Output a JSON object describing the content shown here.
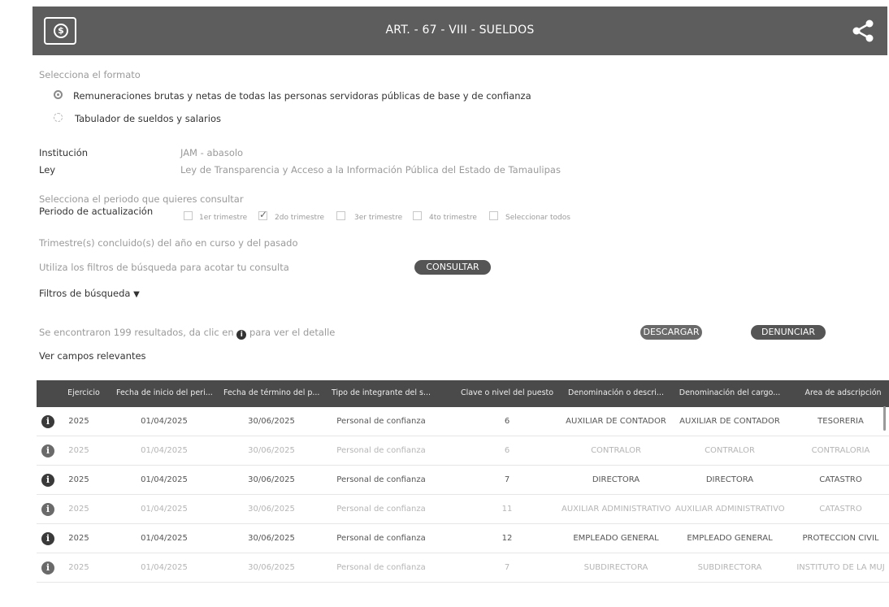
{
  "header": {
    "title": "ART. - 67 - VIII - SUELDOS"
  },
  "format": {
    "prompt": "Selecciona el formato",
    "options": [
      "Remuneraciones brutas y netas de todas las personas servidoras públicas de base y de confianza",
      "Tabulador de sueldos y salarios"
    ],
    "selected_index": 0
  },
  "meta": {
    "institution_label": "Institución",
    "institution_value": "JAM - abasolo",
    "law_label": "Ley",
    "law_value": "Ley de Transparencia y Acceso a la Información Pública del Estado de Tamaulipas"
  },
  "period": {
    "prompt": "Selecciona el periodo que quieres consultar",
    "label": "Periodo de actualización",
    "options": [
      {
        "label": "1er trimestre",
        "checked": false
      },
      {
        "label": "2do trimestre",
        "checked": true
      },
      {
        "label": "3er trimestre",
        "checked": false
      },
      {
        "label": "4to trimestre",
        "checked": false
      },
      {
        "label": "Seleccionar todos",
        "checked": false
      }
    ],
    "note": "Trimestre(s) concluido(s) del año en curso y del pasado"
  },
  "filters": {
    "hint": "Utiliza los filtros de búsqueda para acotar tu consulta",
    "consult_button": "CONSULTAR",
    "toggle_label": "Filtros de búsqueda"
  },
  "results": {
    "summary_prefix": "Se encontraron 199 resultados, da clic en",
    "summary_suffix": "para ver el detalle",
    "download_button": "DESCARGAR",
    "report_button": "DENUNCIAR",
    "relevant_fields_link": "Ver campos relevantes"
  },
  "table": {
    "headers": [
      "Ejercicio",
      "Fecha de inicio del peri...",
      "Fecha de término del p...",
      "Tipo de integrante del s...",
      "Clave o nivel del puesto",
      "Denominación o descri...",
      "Denominación del cargo...",
      "Área de adscripción"
    ],
    "rows": [
      {
        "cells": [
          "2025",
          "01/04/2025",
          "30/06/2025",
          "Personal de confianza",
          "6",
          "AUXILIAR DE CONTADOR",
          "AUXILIAR DE CONTADOR",
          "TESORERÍA"
        ],
        "faded": false
      },
      {
        "cells": [
          "2025",
          "01/04/2025",
          "30/06/2025",
          "Personal de confianza",
          "6",
          "CONTRALOR",
          "CONTRALOR",
          "CONTRALORÍA"
        ],
        "faded": true
      },
      {
        "cells": [
          "2025",
          "01/04/2025",
          "30/06/2025",
          "Personal de confianza",
          "7",
          "DIRECTORA",
          "DIRECTORA",
          "CATASTRO"
        ],
        "faded": false
      },
      {
        "cells": [
          "2025",
          "01/04/2025",
          "30/06/2025",
          "Personal de confianza",
          "11",
          "AUXILIAR ADMINISTRATIVO",
          "AUXILIAR ADMINISTRATIVO",
          "CATASTRO"
        ],
        "faded": true
      },
      {
        "cells": [
          "2025",
          "01/04/2025",
          "30/06/2025",
          "Personal de confianza",
          "12",
          "EMPLEADO GENERAL",
          "EMPLEADO GENERAL",
          "PROTECCIÓN CIVIL"
        ],
        "faded": false
      },
      {
        "cells": [
          "2025",
          "01/04/2025",
          "30/06/2025",
          "Personal de confianza",
          "7",
          "SUBDIRECTORA",
          "SUBDIRECTORA",
          "INSTITUTO DE LA MUJ"
        ],
        "faded": true
      }
    ]
  }
}
